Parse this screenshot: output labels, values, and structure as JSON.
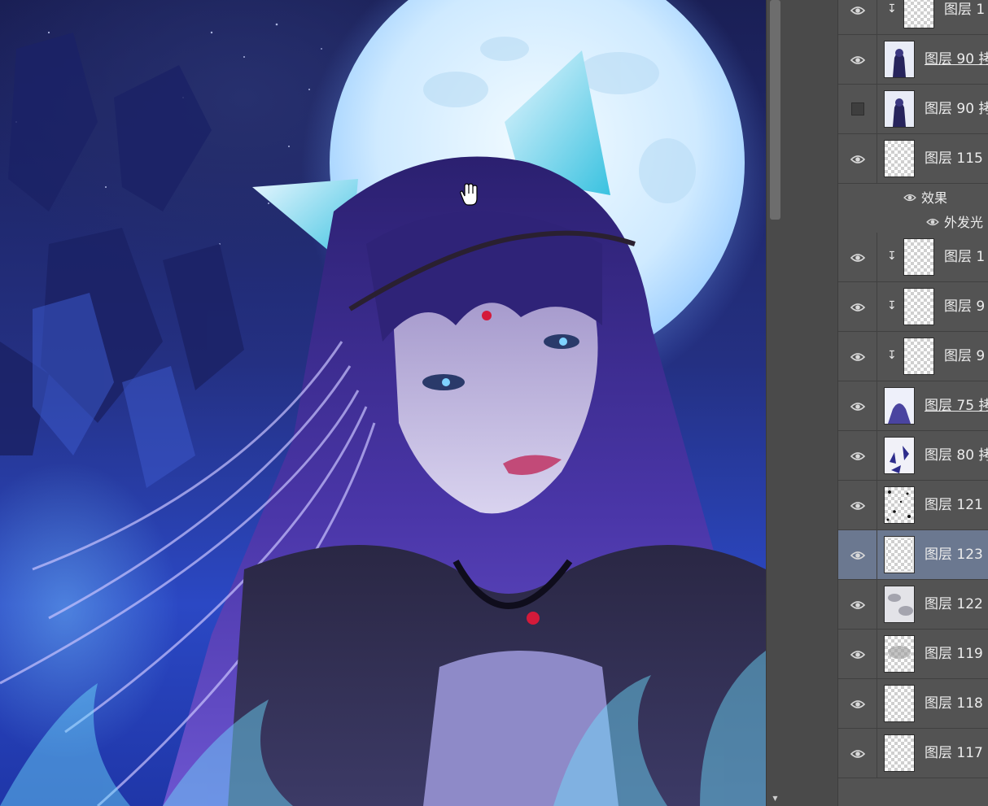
{
  "layers_panel": {
    "rows": [
      {
        "name": "图层 1",
        "visible": true,
        "clipped": true,
        "linked": false,
        "thumb": "transparent"
      },
      {
        "name": "图层 90 拷",
        "visible": true,
        "clipped": false,
        "linked": true,
        "thumb": "figure"
      },
      {
        "name": "图层 90 拷",
        "visible": false,
        "clipped": false,
        "linked": false,
        "thumb": "figure"
      },
      {
        "name": "图层 115",
        "visible": true,
        "clipped": false,
        "linked": false,
        "thumb": "transparent",
        "effects_label": "效果",
        "effects": [
          "外发光"
        ]
      },
      {
        "name": "图层 1",
        "visible": true,
        "clipped": true,
        "linked": false,
        "thumb": "transparent"
      },
      {
        "name": "图层 9",
        "visible": true,
        "clipped": true,
        "linked": false,
        "thumb": "transparent"
      },
      {
        "name": "图层 9",
        "visible": true,
        "clipped": true,
        "linked": false,
        "thumb": "transparent"
      },
      {
        "name": "图层 75 拷",
        "visible": true,
        "clipped": false,
        "linked": true,
        "thumb": "figure-small"
      },
      {
        "name": "图层 80 拷",
        "visible": true,
        "clipped": false,
        "linked": false,
        "thumb": "splash"
      },
      {
        "name": "图层 121",
        "visible": true,
        "clipped": false,
        "linked": false,
        "thumb": "specks"
      },
      {
        "name": "图层 123",
        "visible": true,
        "clipped": false,
        "linked": false,
        "thumb": "transparent",
        "selected": true
      },
      {
        "name": "图层 122",
        "visible": true,
        "clipped": false,
        "linked": false,
        "thumb": "texture"
      },
      {
        "name": "图层 119",
        "visible": true,
        "clipped": false,
        "linked": false,
        "thumb": "smudge"
      },
      {
        "name": "图层 118",
        "visible": true,
        "clipped": false,
        "linked": false,
        "thumb": "transparent"
      },
      {
        "name": "图层 117",
        "visible": true,
        "clipped": false,
        "linked": false,
        "thumb": "transparent"
      }
    ]
  },
  "canvas": {
    "tool_cursor": "hand-cursor-icon",
    "colors": {
      "sky": "#243082",
      "moon": "#dff2ff",
      "hair": "#3b2a8a",
      "glow": "#7fe4ff"
    }
  },
  "theme": {
    "panel_bg": "#535353",
    "selected_row": "#6b7890",
    "text": "#ececec"
  }
}
